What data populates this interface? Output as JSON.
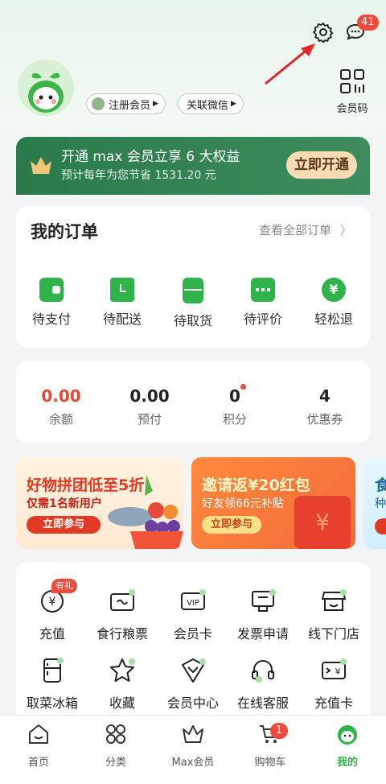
{
  "header": {
    "messages_badge": "41",
    "register_label": "注册会员",
    "wechat_label": "关联微信",
    "member_code_label": "会员码"
  },
  "banner": {
    "title": "开通 max 会员立享 6 大权益",
    "subtitle": "预计每年为您节省 1531.20 元",
    "button": "立即开通"
  },
  "orders": {
    "title": "我的订单",
    "view_all": "查看全部订单",
    "items": [
      "待支付",
      "待配送",
      "待取货",
      "待评价",
      "轻松退"
    ]
  },
  "assets": {
    "items": [
      {
        "value": "0.00",
        "label": "余额"
      },
      {
        "value": "0.00",
        "label": "预付"
      },
      {
        "value": "0",
        "label": "积分"
      },
      {
        "value": "4",
        "label": "优惠券"
      }
    ]
  },
  "promos": {
    "card1": {
      "title": "好物拼团低至5折",
      "subtitle": "仅需1名新用户",
      "button": "立即参与"
    },
    "card2": {
      "title": "邀请返¥20红包",
      "subtitle": "好友领66元补贴",
      "button": "立即参与"
    },
    "card3": {
      "title": "食",
      "subtitle": "种"
    }
  },
  "services": {
    "gift_tag": "有礼",
    "items": [
      "充值",
      "食行粮票",
      "会员卡",
      "发票申请",
      "线下门店",
      "取菜冰箱",
      "收藏",
      "会员中心",
      "在线客服",
      "充值卡"
    ]
  },
  "tabbar": {
    "items": [
      "首页",
      "分类",
      "Max会员",
      "购物车",
      "我的"
    ],
    "cart_badge": "1"
  },
  "colors": {
    "brand_green": "#2fb34a",
    "banner_green": "#2e7d4f",
    "red": "#f04b3a"
  }
}
